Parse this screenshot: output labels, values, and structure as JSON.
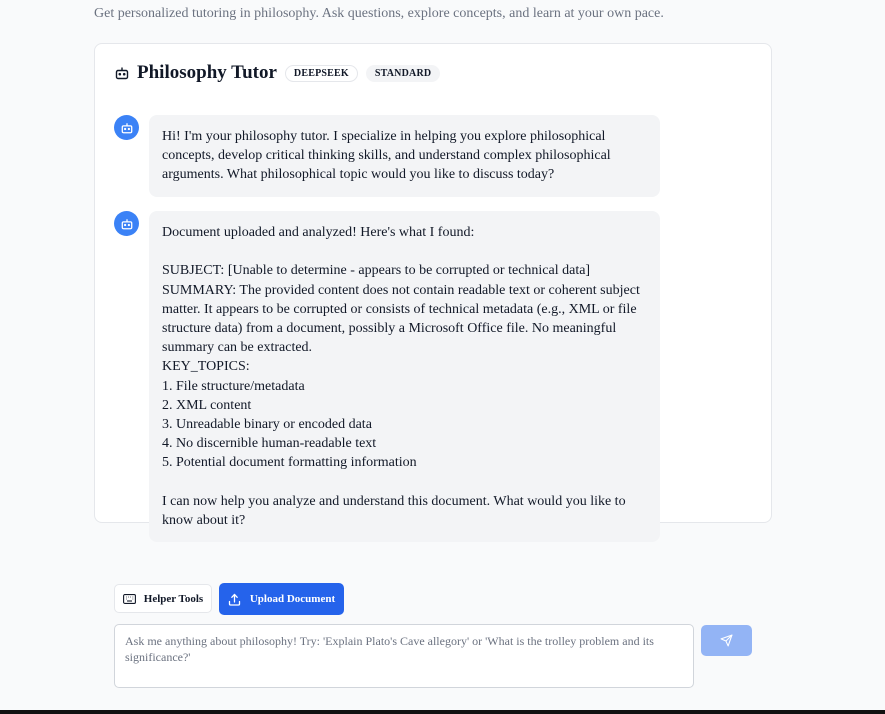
{
  "page": {
    "subtitle": "Get personalized tutoring in philosophy. Ask questions, explore concepts, and learn at your own pace."
  },
  "chat": {
    "title": "Philosophy Tutor",
    "badges": [
      "DEEPSEEK",
      "STANDARD"
    ],
    "header_icon": "bot-icon",
    "messages": [
      {
        "role": "assistant",
        "avatar_icon": "bot-icon",
        "text": "Hi! I'm your philosophy tutor. I specialize in helping you explore philosophical concepts, develop critical thinking skills, and understand complex philosophical arguments. What philosophical topic would you like to discuss today?"
      },
      {
        "role": "assistant",
        "avatar_icon": "bot-icon",
        "text": "Document uploaded and analyzed! Here's what I found:\n\nSUBJECT: [Unable to determine - appears to be corrupted or technical data]\nSUMMARY: The provided content does not contain readable text or coherent subject matter. It appears to be corrupted or consists of technical metadata (e.g., XML or file structure data) from a document, possibly a Microsoft Office file. No meaningful summary can be extracted.\nKEY_TOPICS:\n1. File structure/metadata\n2. XML content\n3. Unreadable binary or encoded data\n4. No discernible human-readable text\n5. Potential document formatting information\n\nI can now help you analyze and understand this document. What would you like to know about it?"
      }
    ]
  },
  "toolbar": {
    "helper_label": "Helper Tools",
    "helper_icon": "keyboard-icon",
    "upload_label": "Upload Document",
    "upload_icon": "upload-icon"
  },
  "input": {
    "value": "",
    "placeholder": "Ask me anything about philosophy! Try: 'Explain Plato's Cave allegory' or 'What is the trolley problem and its significance?'"
  },
  "send": {
    "icon": "send-icon"
  },
  "colors": {
    "accent": "#2563eb",
    "avatar": "#3b82f6",
    "bubble": "#f3f4f6",
    "send_disabled": "#93b4f5",
    "background": "#f9fafb"
  }
}
